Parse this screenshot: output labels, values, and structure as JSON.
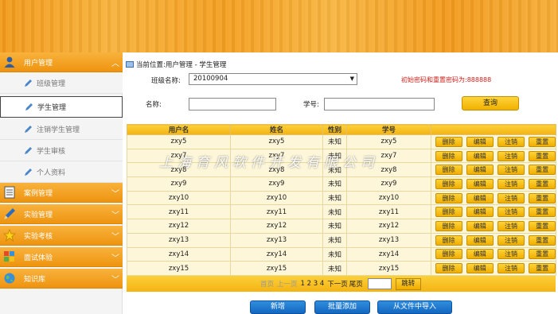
{
  "sidebar": {
    "groups": [
      {
        "label": "用户管理",
        "icon": "user-icon",
        "expanded": true
      },
      {
        "label": "案例管理",
        "icon": "document-icon"
      },
      {
        "label": "实验管理",
        "icon": "pencil-icon"
      },
      {
        "label": "实验考核",
        "icon": "star-icon"
      },
      {
        "label": "面试体验",
        "icon": "puzzle-icon"
      },
      {
        "label": "知识库",
        "icon": "globe-icon"
      }
    ],
    "sub_items": [
      {
        "label": "班级管理",
        "icon": "pencil-icon"
      },
      {
        "label": "学生管理",
        "icon": "pencil-icon",
        "active": true
      },
      {
        "label": "注销学生管理",
        "icon": "pencil-icon"
      },
      {
        "label": "学生审核",
        "icon": "pencil-icon"
      },
      {
        "label": "个人资料",
        "icon": "pencil-icon"
      }
    ]
  },
  "breadcrumb": "当前位置:用户管理 - 学生管理",
  "filters": {
    "class_label": "班级名称:",
    "class_value": "20100904",
    "hint": "初始密码和重置密码为:888888",
    "name_label": "名称:",
    "name_value": "",
    "student_no_label": "学号:",
    "student_no_value": "",
    "query_button": "查询"
  },
  "table": {
    "columns": [
      "用户名",
      "姓名",
      "性别",
      "学号"
    ],
    "actions": [
      "删除",
      "编辑",
      "注销",
      "重置"
    ],
    "rows": [
      [
        "zxy5",
        "zxy5",
        "未知",
        "zxy5"
      ],
      [
        "zxy7",
        "zxy7",
        "未知",
        "zxy7"
      ],
      [
        "zxy8",
        "zxy8",
        "未知",
        "zxy8"
      ],
      [
        "zxy9",
        "zxy9",
        "未知",
        "zxy9"
      ],
      [
        "zxy10",
        "zxy10",
        "未知",
        "zxy10"
      ],
      [
        "zxy11",
        "zxy11",
        "未知",
        "zxy11"
      ],
      [
        "zxy12",
        "zxy12",
        "未知",
        "zxy12"
      ],
      [
        "zxy13",
        "zxy13",
        "未知",
        "zxy13"
      ],
      [
        "zxy14",
        "zxy14",
        "未知",
        "zxy14"
      ],
      [
        "zxy15",
        "zxy15",
        "未知",
        "zxy15"
      ]
    ]
  },
  "pager": {
    "first": "首页",
    "prev": "上一页",
    "pages": "1 2 3 4",
    "next": "下一页",
    "last": "尾页",
    "go": "跳转"
  },
  "bottom_buttons": [
    "新增",
    "批量添加",
    "从文件中导入"
  ],
  "watermark": "上海育风软件开发有限公司",
  "colors": {
    "accent": "#f4a621",
    "hint": "#d0201a",
    "bottom_button": "#1f7ad1"
  }
}
